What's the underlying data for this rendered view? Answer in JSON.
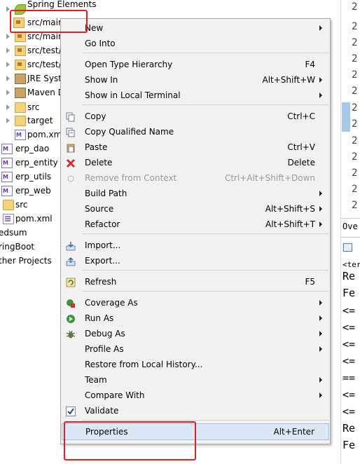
{
  "explorer": {
    "rows": [
      {
        "label": "Spring Elements"
      },
      {
        "label": "src/main"
      },
      {
        "label": "src/main"
      },
      {
        "label": "src/test/"
      },
      {
        "label": "src/test/"
      },
      {
        "label": "JRE Syst"
      },
      {
        "label": "Maven D"
      },
      {
        "label": "src"
      },
      {
        "label": "target"
      },
      {
        "label": "pom.xml"
      },
      {
        "label": "erp_dao"
      },
      {
        "label": "erp_entity"
      },
      {
        "label": "erp_utils"
      },
      {
        "label": "erp_web"
      },
      {
        "label": "src"
      },
      {
        "label": "pom.xml"
      },
      {
        "label": "edsum"
      },
      {
        "label": "ringBoot"
      },
      {
        "label": "ther Projects"
      }
    ]
  },
  "right_panel": {
    "line_numbers": [
      "2",
      "2",
      "2",
      "2",
      "2",
      "2",
      "2",
      "2",
      "2",
      "2",
      "2",
      "2",
      "2",
      "2",
      "2"
    ],
    "tab_label": "Ove",
    "console_tag": "<ter",
    "console_lines": [
      "Re",
      "Fe",
      "<=",
      "<=",
      "<=",
      "<=",
      "==",
      "<=",
      "<=",
      "Re",
      "Fe"
    ]
  },
  "context_menu": {
    "items": [
      {
        "label": "New",
        "shortcut": "",
        "submenu": true
      },
      {
        "label": "Go Into",
        "shortcut": "",
        "submenu": false
      },
      {
        "label": "Open Type Hierarchy",
        "shortcut": "F4",
        "submenu": false
      },
      {
        "label": "Show In",
        "shortcut": "Alt+Shift+W",
        "submenu": true
      },
      {
        "label": "Show in Local Terminal",
        "shortcut": "",
        "submenu": true
      },
      {
        "label": "Copy",
        "shortcut": "Ctrl+C",
        "submenu": false
      },
      {
        "label": "Copy Qualified Name",
        "shortcut": "",
        "submenu": false
      },
      {
        "label": "Paste",
        "shortcut": "Ctrl+V",
        "submenu": false
      },
      {
        "label": "Delete",
        "shortcut": "Delete",
        "submenu": false
      },
      {
        "label": "Remove from Context",
        "shortcut": "Ctrl+Alt+Shift+Down",
        "submenu": false,
        "disabled": true
      },
      {
        "label": "Build Path",
        "shortcut": "",
        "submenu": true
      },
      {
        "label": "Source",
        "shortcut": "Alt+Shift+S",
        "submenu": true
      },
      {
        "label": "Refactor",
        "shortcut": "Alt+Shift+T",
        "submenu": true
      },
      {
        "label": "Import...",
        "shortcut": "",
        "submenu": false
      },
      {
        "label": "Export...",
        "shortcut": "",
        "submenu": false
      },
      {
        "label": "Refresh",
        "shortcut": "F5",
        "submenu": false
      },
      {
        "label": "Coverage As",
        "shortcut": "",
        "submenu": true
      },
      {
        "label": "Run As",
        "shortcut": "",
        "submenu": true
      },
      {
        "label": "Debug As",
        "shortcut": "",
        "submenu": true
      },
      {
        "label": "Profile As",
        "shortcut": "",
        "submenu": true
      },
      {
        "label": "Restore from Local History...",
        "shortcut": "",
        "submenu": false
      },
      {
        "label": "Team",
        "shortcut": "",
        "submenu": true
      },
      {
        "label": "Compare With",
        "shortcut": "",
        "submenu": true
      },
      {
        "label": "Validate",
        "shortcut": "",
        "submenu": false
      },
      {
        "label": "Properties",
        "shortcut": "Alt+Enter",
        "submenu": false
      }
    ]
  },
  "colors": {
    "annotation_red": "#e02020",
    "menu_bg": "#f2f2f2",
    "selection_bg": "#dde8f6"
  }
}
